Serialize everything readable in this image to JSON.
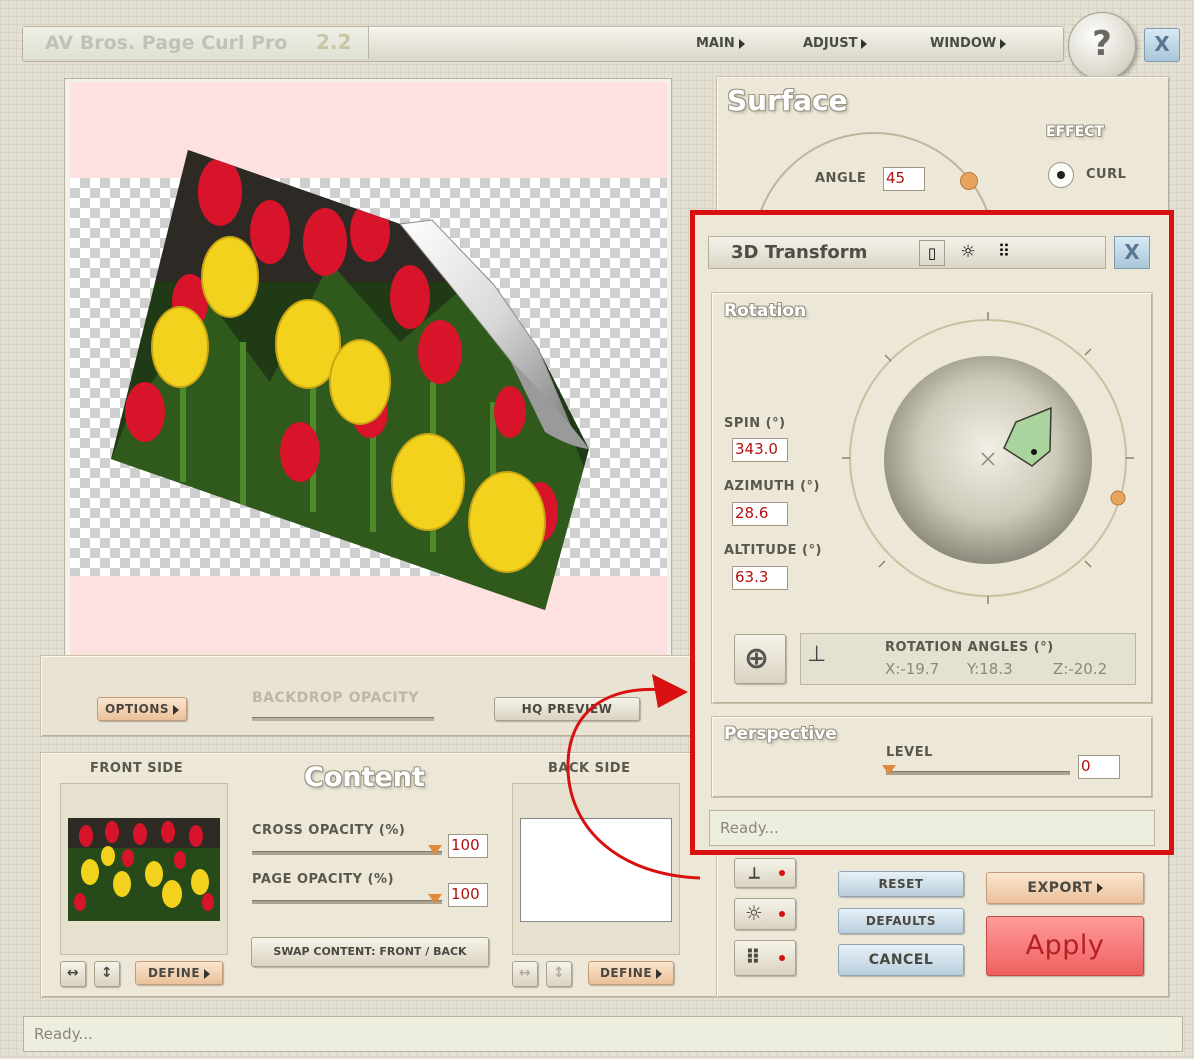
{
  "window": {
    "title": "AV Bros. Page Curl Pro",
    "version": "2.2"
  },
  "menu": {
    "main": "MAIN",
    "adjust": "ADJUST",
    "window": "WINDOW"
  },
  "help_label": "?",
  "close_label": "X",
  "surface": {
    "title": "Surface",
    "angle_label": "ANGLE",
    "angle_value": "45",
    "effect_label": "EFFECT",
    "effect_curl": "CURL"
  },
  "preview": {
    "options_btn": "OPTIONS",
    "backdrop_opacity": "BACKDROP OPACITY",
    "hq_preview": "HQ PREVIEW"
  },
  "content": {
    "title": "Content",
    "front_side": "FRONT SIDE",
    "back_side": "BACK SIDE",
    "cross_opacity_label": "CROSS OPACITY (%)",
    "cross_opacity_value": "100",
    "page_opacity_label": "PAGE OPACITY (%)",
    "page_opacity_value": "100",
    "swap_btn": "SWAP CONTENT: FRONT / BACK",
    "define_front": "DEFINE",
    "define_back": "DEFINE"
  },
  "actions": {
    "reset": "RESET",
    "defaults": "DEFAULTS",
    "cancel": "CANCEL",
    "export": "EXPORT",
    "apply": "Apply"
  },
  "transform": {
    "title": "3D Transform",
    "close_label": "X",
    "rotation_title": "Rotation",
    "spin_label": "SPIN (°)",
    "spin_value": "343.0",
    "azimuth_label": "AZIMUTH (°)",
    "azimuth_value": "28.6",
    "altitude_label": "ALTITUDE (°)",
    "altitude_value": "63.3",
    "rotation_angles_label": "ROTATION ANGLES (°)",
    "rotation_x": "X:-19.7",
    "rotation_y": "Y:18.3",
    "rotation_z": "Z:-20.2",
    "perspective_title": "Perspective",
    "level_label": "LEVEL",
    "level_value": "0",
    "status": "Ready..."
  },
  "status_bar": "Ready...",
  "colors": {
    "highlight_frame": "#d81010",
    "apply_button": "#ef6a6a",
    "canvas_bg": "#fde0e0"
  }
}
